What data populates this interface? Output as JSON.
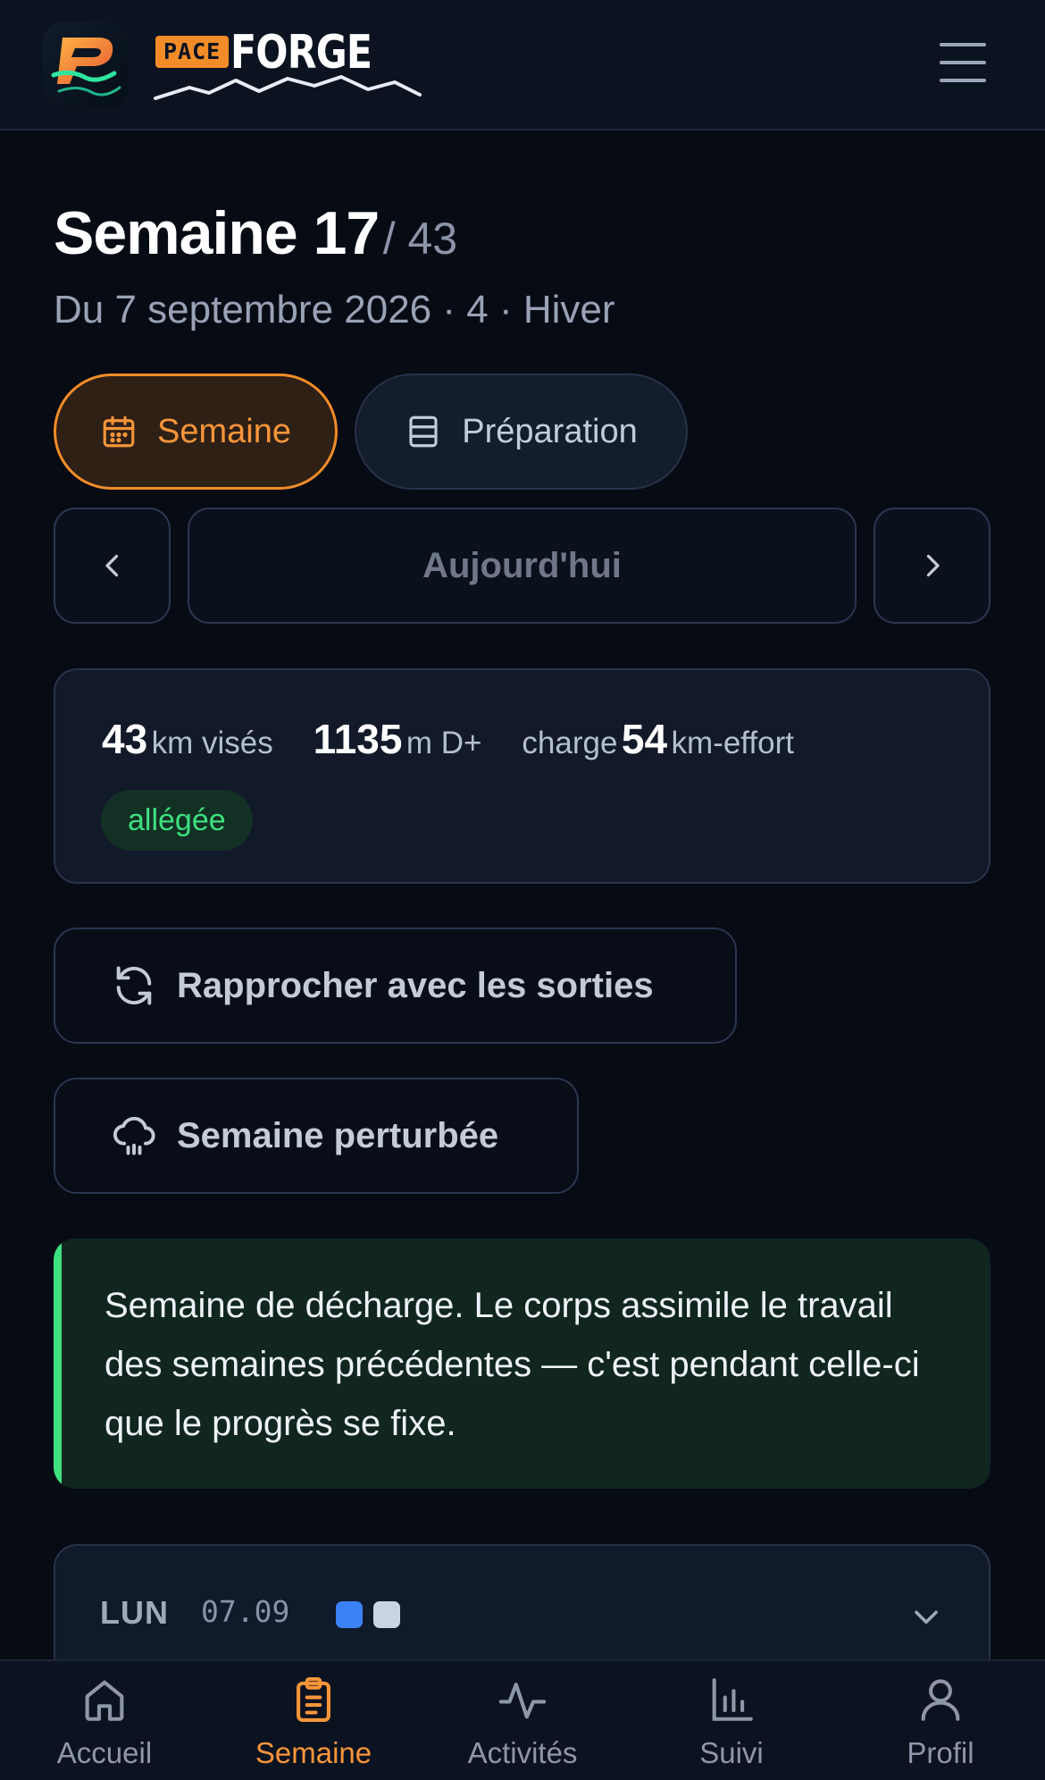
{
  "header": {
    "logo_pace": "PACE",
    "logo_forge": "FORGE"
  },
  "week": {
    "title": "Semaine 17",
    "total": "/ 43",
    "subtitle": "Du 7 septembre 2026 · 4 · Hiver"
  },
  "tabs": [
    {
      "label": "Semaine",
      "icon": "calendar-icon",
      "active": true
    },
    {
      "label": "Préparation",
      "icon": "layout-icon",
      "active": false
    }
  ],
  "nav": {
    "today_label": "Aujourd'hui"
  },
  "stats": {
    "km_value": "43",
    "km_unit": "km visés",
    "elevation_value": "1135",
    "elevation_unit": "m D+",
    "charge_label": "charge",
    "charge_value": "54",
    "charge_unit": "km-effort",
    "badge": "allégée"
  },
  "actions": {
    "sync_label": "Rapprocher avec les sorties",
    "disrupted_label": "Semaine perturbée"
  },
  "info": {
    "text": "Semaine de décharge. Le corps assimile le travail des semaines précédentes — c'est pendant celle-ci que le progrès se fixe."
  },
  "days": [
    {
      "name": "LUN",
      "date": "07.09",
      "dots": [
        "#3b82f6",
        "#c8d3e3"
      ]
    }
  ],
  "bottom_nav": [
    {
      "label": "Accueil",
      "icon": "home-icon",
      "active": false
    },
    {
      "label": "Semaine",
      "icon": "clipboard-icon",
      "active": true
    },
    {
      "label": "Activités",
      "icon": "activity-icon",
      "active": false
    },
    {
      "label": "Suivi",
      "icon": "bar-chart-icon",
      "active": false
    },
    {
      "label": "Profil",
      "icon": "user-icon",
      "active": false
    }
  ],
  "colors": {
    "accent": "#f28c28",
    "success": "#3ee07f",
    "background": "#070b14"
  }
}
